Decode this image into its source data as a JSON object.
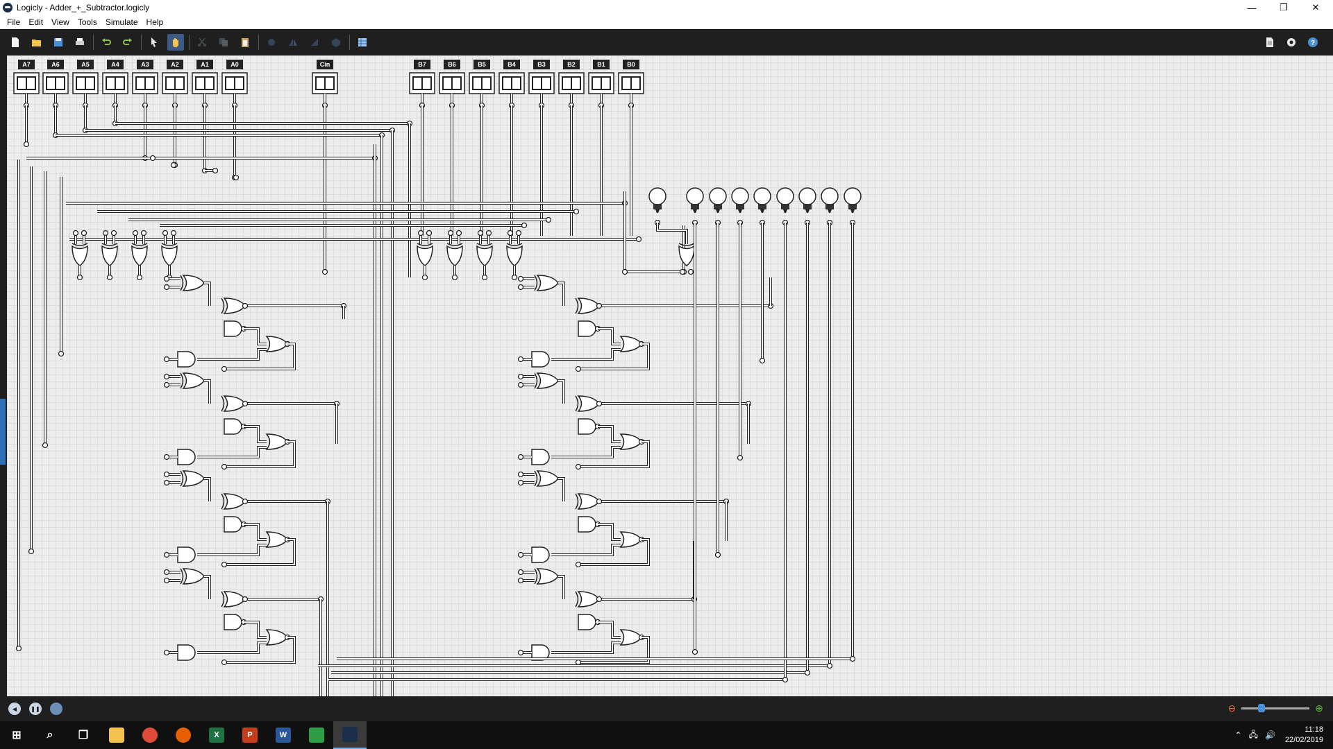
{
  "window": {
    "title": "Logicly - Adder_+_Subtractor.logicly",
    "minimize": "—",
    "restore": "❐",
    "close": "✕"
  },
  "menu": [
    "File",
    "Edit",
    "View",
    "Tools",
    "Simulate",
    "Help"
  ],
  "toolbar": {
    "tools": [
      "new-icon",
      "open-icon",
      "save-icon",
      "print-icon",
      "undo-icon",
      "redo-icon",
      "pointer-icon",
      "hand-icon",
      "cut-icon",
      "copy-icon",
      "paste-icon",
      "rotate-icon",
      "flip-horizontal-icon",
      "flip-vertical-icon",
      "group-icon",
      "table-icon"
    ],
    "active": "hand-icon",
    "right": [
      "document-icon",
      "settings-icon",
      "help-icon"
    ]
  },
  "circuit": {
    "inputs_a": [
      "A7",
      "A6",
      "A5",
      "A4",
      "A3",
      "A2",
      "A1",
      "A0"
    ],
    "input_cin": "Cin",
    "inputs_b": [
      "B7",
      "B6",
      "B5",
      "B4",
      "B3",
      "B2",
      "B1",
      "B0"
    ],
    "output_bulbs": 9
  },
  "status": {
    "zoom_level": 0.27
  },
  "taskbar": {
    "apps": [
      {
        "name": "windows-start-icon",
        "label": "⊞",
        "color": "#ffffff"
      },
      {
        "name": "search-icon",
        "label": "⌕",
        "color": "#ffffff"
      },
      {
        "name": "task-view-icon",
        "label": "❐",
        "color": "#ffffff"
      },
      {
        "name": "file-explorer-icon",
        "label": "",
        "color": "#f2c14e"
      },
      {
        "name": "chrome-icon",
        "label": "",
        "color": "#de4b3b"
      },
      {
        "name": "firefox-icon",
        "label": "",
        "color": "#e66000"
      },
      {
        "name": "excel-icon",
        "label": "X",
        "color": "#1f7244"
      },
      {
        "name": "powerpoint-icon",
        "label": "P",
        "color": "#c43e1c"
      },
      {
        "name": "word-icon",
        "label": "W",
        "color": "#2b579a"
      },
      {
        "name": "spreadsheet-app-icon",
        "label": "",
        "color": "#2e9b46"
      },
      {
        "name": "logicly-icon",
        "label": "",
        "color": "#1c2f4a"
      }
    ],
    "time": "11:18",
    "date": "22/02/2019"
  }
}
